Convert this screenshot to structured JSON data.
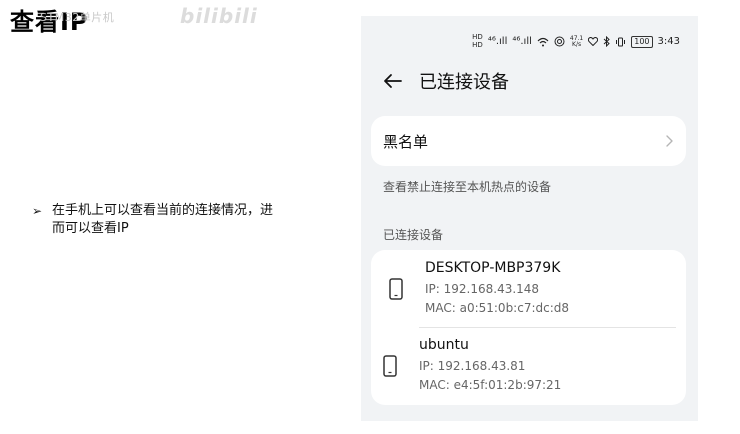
{
  "slide": {
    "title": "查看IP",
    "watermark": "STM32单片机",
    "watermark_logo": "bilibili",
    "bullet_marker": "➢",
    "bullet_text": "在手机上可以查看当前的连接情况，进而可以查看IP"
  },
  "statusbar": {
    "sim_icons": [
      "HD",
      "HD"
    ],
    "signal1": "⁴⁶.ıll",
    "signal2": "⁴⁶.ıll",
    "speed_value": "47.1",
    "speed_unit": "K/s",
    "battery": "100",
    "time": "3:43",
    "icons": [
      "wifi-icon",
      "hotspot-icon",
      "heart-icon",
      "bluetooth-icon",
      "vibrate-icon",
      "battery-icon"
    ]
  },
  "appbar": {
    "title": "已连接设备"
  },
  "blacklist": {
    "label": "黑名单"
  },
  "hint": "查看禁止连接至本机热点的设备",
  "section_title": "已连接设备",
  "devices": [
    {
      "name": "DESKTOP-MBP379K",
      "ip": "IP: 192.168.43.148",
      "mac": "MAC: a0:51:0b:c7:dc:d8"
    },
    {
      "name": "ubuntu",
      "ip": "IP: 192.168.43.81",
      "mac": "MAC: e4:5f:01:2b:97:21"
    }
  ]
}
